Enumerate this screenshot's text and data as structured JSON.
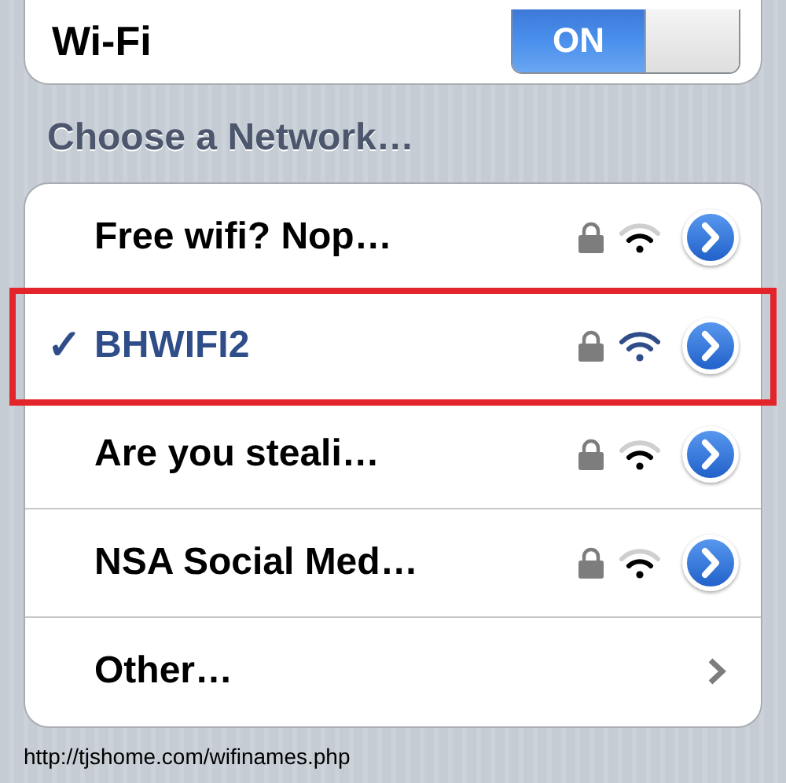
{
  "wifi": {
    "label": "Wi-Fi",
    "toggle": {
      "text": "ON",
      "on": true
    }
  },
  "section_header": "Choose a Network…",
  "networks": [
    {
      "kind": "network",
      "name": "Free wifi? Nop…",
      "selected": false,
      "highlighted": false,
      "secured": true,
      "full_signal": false
    },
    {
      "kind": "network",
      "name": "BHWIFI2",
      "selected": true,
      "highlighted": true,
      "secured": true,
      "full_signal": true,
      "check": "✓"
    },
    {
      "kind": "network",
      "name": "Are you steali…",
      "selected": false,
      "highlighted": false,
      "secured": true,
      "full_signal": false
    },
    {
      "kind": "network",
      "name": "NSA Social Med…",
      "selected": false,
      "highlighted": false,
      "secured": true,
      "full_signal": false
    },
    {
      "kind": "other",
      "name": "Other…",
      "selected": false,
      "highlighted": false
    }
  ],
  "source_url": "http://tjshome.com/wifinames.php"
}
